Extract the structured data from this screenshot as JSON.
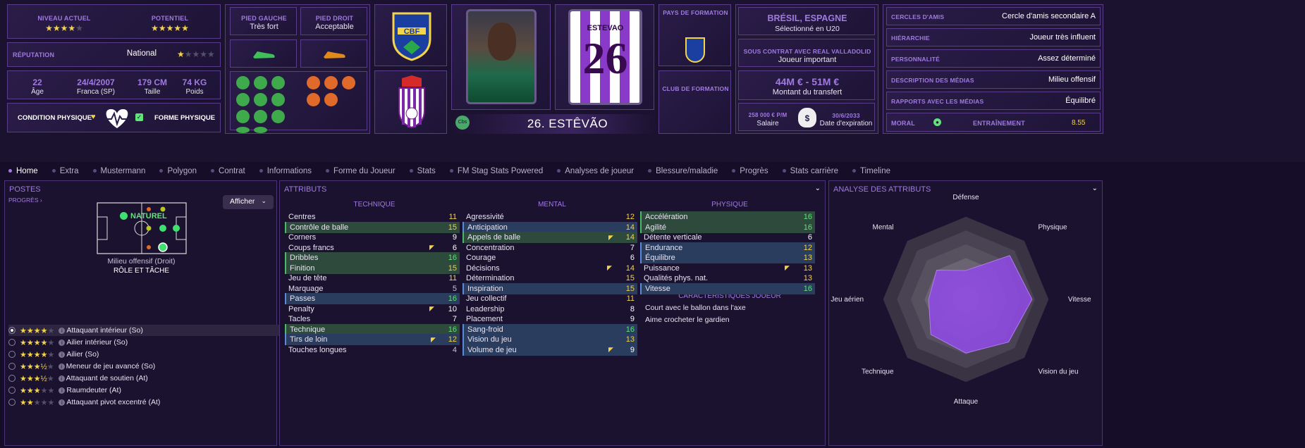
{
  "header": {
    "niveau_actuel_label": "NIVEAU ACTUEL",
    "niveau_actuel_stars": "★★★★",
    "niveau_actuel_off": "★",
    "potentiel_label": "POTENTIEL",
    "potentiel_stars": "★★★★★",
    "potentiel_off": "",
    "reputation_label": "RÉPUTATION",
    "reputation_value": "National",
    "reputation_stars": "★",
    "reputation_off": "★★★★",
    "age": "22",
    "age_label": "Âge",
    "birth": "24/4/2007",
    "birthplace": "Franca (SP)",
    "height": "179 CM",
    "height_label": "Taille",
    "weight": "74 KG",
    "weight_label": "Poids",
    "condition_label": "CONDITION PHYSIQUE",
    "forme_label": "FORME PHYSIQUE",
    "pied_gauche_label": "PIED GAUCHE",
    "pied_gauche": "Très fort",
    "pied_droit_label": "PIED DROIT",
    "pied_droit": "Acceptable",
    "player_name": "26. ESTÊVÃO",
    "shirt_name": "ESTEVAO",
    "shirt_number": "26",
    "cbs_badge": "Cbs",
    "cbf_text": "CBF",
    "pays_formation_label": "PAYS DE FORMATION",
    "club_formation_label": "CLUB DE FORMATION",
    "nationality": "BRÉSIL, ESPAGNE",
    "selection": "Sélectionné en U20",
    "contrat_label": "SOUS CONTRAT AVEC REAL VALLADOLID",
    "contrat_role": "Joueur important",
    "transfer_value": "44M € - 51M €",
    "transfer_label": "Montant du transfert",
    "salaire_value": "258 000 € P/M",
    "salaire_label": "Salaire",
    "expiration_value": "30/6/2033",
    "expiration_label": "Date d'expiration",
    "info_rows": [
      {
        "label": "CERCLES D'AMIS",
        "value": "Cercle d'amis secondaire A"
      },
      {
        "label": "HIÉRARCHIE",
        "value": "Joueur très influent"
      },
      {
        "label": "PERSONNALITÉ",
        "value": "Assez déterminé"
      },
      {
        "label": "DESCRIPTION DES MÉDIAS",
        "value": "Milieu offensif"
      },
      {
        "label": "RAPPORTS AVEC LES MÉDIAS",
        "value": "Équilibré"
      }
    ],
    "moral_label": "MORAL",
    "entrainement_label": "ENTRAÎNEMENT",
    "entrainement_value": "8.55"
  },
  "nav": [
    "Home",
    "Extra",
    "Mustermann",
    "Polygon",
    "Contrat",
    "Informations",
    "Forme du Joueur",
    "Stats",
    "FM Stag Stats Powered",
    "Analyses de joueur",
    "Blessure/maladie",
    "Progrès",
    "Stats carrière",
    "Timeline"
  ],
  "postes": {
    "title": "POSTES",
    "progres": "PROGRÈS",
    "afficher": "Afficher",
    "naturel": "NATUREL",
    "position_name": "Milieu offensif (Droit)",
    "role_title": "RÔLE ET TÂCHE",
    "roles": [
      {
        "stars": "★★★★",
        "off": "★",
        "name": "Attaquant intérieur (So)"
      },
      {
        "stars": "★★★★",
        "off": "★",
        "name": "Ailier intérieur (So)"
      },
      {
        "stars": "★★★★",
        "off": "★",
        "name": "Ailier (So)"
      },
      {
        "stars": "★★★½",
        "off": "★",
        "name": "Meneur de jeu avancé (So)"
      },
      {
        "stars": "★★★½",
        "off": "★",
        "name": "Attaquant de soutien (At)"
      },
      {
        "stars": "★★★",
        "off": "★★",
        "name": "Raumdeuter (At)"
      },
      {
        "stars": "★★",
        "off": "★★★",
        "name": "Attaquant pivot excentré (At)"
      }
    ]
  },
  "attributs": {
    "title": "ATTRIBUTS",
    "technique_title": "TECHNIQUE",
    "mental_title": "MENTAL",
    "physique_title": "PHYSIQUE",
    "caract_title": "CARACTÉRISTIQUES JOUEUR",
    "technique": [
      {
        "name": "Centres",
        "value": "11",
        "hl": "",
        "c": "y",
        "arrow": false
      },
      {
        "name": "Contrôle de balle",
        "value": "15",
        "hl": "g",
        "c": "y",
        "arrow": false
      },
      {
        "name": "Corners",
        "value": "9",
        "hl": "",
        "c": "w",
        "arrow": false
      },
      {
        "name": "Coups francs",
        "value": "6",
        "hl": "",
        "c": "w",
        "arrow": true
      },
      {
        "name": "Dribbles",
        "value": "16",
        "hl": "g",
        "c": "g",
        "arrow": false
      },
      {
        "name": "Finition",
        "value": "15",
        "hl": "g",
        "c": "y",
        "arrow": false
      },
      {
        "name": "Jeu de tête",
        "value": "11",
        "hl": "",
        "c": "y",
        "arrow": false
      },
      {
        "name": "Marquage",
        "value": "5",
        "hl": "",
        "c": "gr",
        "arrow": false
      },
      {
        "name": "Passes",
        "value": "16",
        "hl": "b",
        "c": "g",
        "arrow": false
      },
      {
        "name": "Penalty",
        "value": "10",
        "hl": "",
        "c": "w",
        "arrow": true
      },
      {
        "name": "Tacles",
        "value": "7",
        "hl": "",
        "c": "w",
        "arrow": false
      },
      {
        "name": "Technique",
        "value": "16",
        "hl": "g",
        "c": "g",
        "arrow": false
      },
      {
        "name": "Tirs de loin",
        "value": "12",
        "hl": "b",
        "c": "y",
        "arrow": true
      },
      {
        "name": "Touches longues",
        "value": "4",
        "hl": "",
        "c": "gr",
        "arrow": false
      }
    ],
    "mental": [
      {
        "name": "Agressivité",
        "value": "12",
        "hl": "",
        "c": "y",
        "arrow": false
      },
      {
        "name": "Anticipation",
        "value": "14",
        "hl": "b",
        "c": "y",
        "arrow": false
      },
      {
        "name": "Appels de balle",
        "value": "14",
        "hl": "g",
        "c": "y",
        "arrow": true
      },
      {
        "name": "Concentration",
        "value": "7",
        "hl": "",
        "c": "w",
        "arrow": false
      },
      {
        "name": "Courage",
        "value": "6",
        "hl": "",
        "c": "w",
        "arrow": false
      },
      {
        "name": "Décisions",
        "value": "14",
        "hl": "",
        "c": "y",
        "arrow": true
      },
      {
        "name": "Détermination",
        "value": "15",
        "hl": "",
        "c": "y",
        "arrow": false
      },
      {
        "name": "Inspiration",
        "value": "15",
        "hl": "b",
        "c": "y",
        "arrow": false
      },
      {
        "name": "Jeu collectif",
        "value": "11",
        "hl": "",
        "c": "y",
        "arrow": false
      },
      {
        "name": "Leadership",
        "value": "8",
        "hl": "",
        "c": "w",
        "arrow": false
      },
      {
        "name": "Placement",
        "value": "9",
        "hl": "",
        "c": "w",
        "arrow": false
      },
      {
        "name": "Sang-froid",
        "value": "16",
        "hl": "b",
        "c": "g",
        "arrow": false
      },
      {
        "name": "Vision du jeu",
        "value": "13",
        "hl": "b",
        "c": "y",
        "arrow": false
      },
      {
        "name": "Volume de jeu",
        "value": "9",
        "hl": "b",
        "c": "w",
        "arrow": true
      }
    ],
    "physique": [
      {
        "name": "Accélération",
        "value": "16",
        "hl": "g",
        "c": "g",
        "arrow": false
      },
      {
        "name": "Agilité",
        "value": "16",
        "hl": "g",
        "c": "g",
        "arrow": false
      },
      {
        "name": "Détente verticale",
        "value": "6",
        "hl": "",
        "c": "w",
        "arrow": false
      },
      {
        "name": "Endurance",
        "value": "12",
        "hl": "b",
        "c": "y",
        "arrow": false
      },
      {
        "name": "Équilibre",
        "value": "13",
        "hl": "b",
        "c": "y",
        "arrow": false
      },
      {
        "name": "Puissance",
        "value": "13",
        "hl": "",
        "c": "y",
        "arrow": true
      },
      {
        "name": "Qualités phys. nat.",
        "value": "13",
        "hl": "",
        "c": "y",
        "arrow": false
      },
      {
        "name": "Vitesse",
        "value": "16",
        "hl": "b",
        "c": "g",
        "arrow": false
      }
    ],
    "caracteristiques": [
      "Court avec le ballon dans l'axe",
      "Aime crocheter le gardien"
    ]
  },
  "analyse": {
    "title": "ANALYSE DES ATTRIBUTS",
    "chart_data": {
      "type": "radar",
      "categories": [
        "Défense",
        "Physique",
        "Vitesse",
        "Vision du jeu",
        "Attaque",
        "Technique",
        "Jeu aérien",
        "Mental"
      ],
      "values": [
        0.35,
        0.75,
        0.8,
        0.73,
        0.65,
        0.6,
        0.45,
        0.5
      ],
      "max": 1
    }
  }
}
